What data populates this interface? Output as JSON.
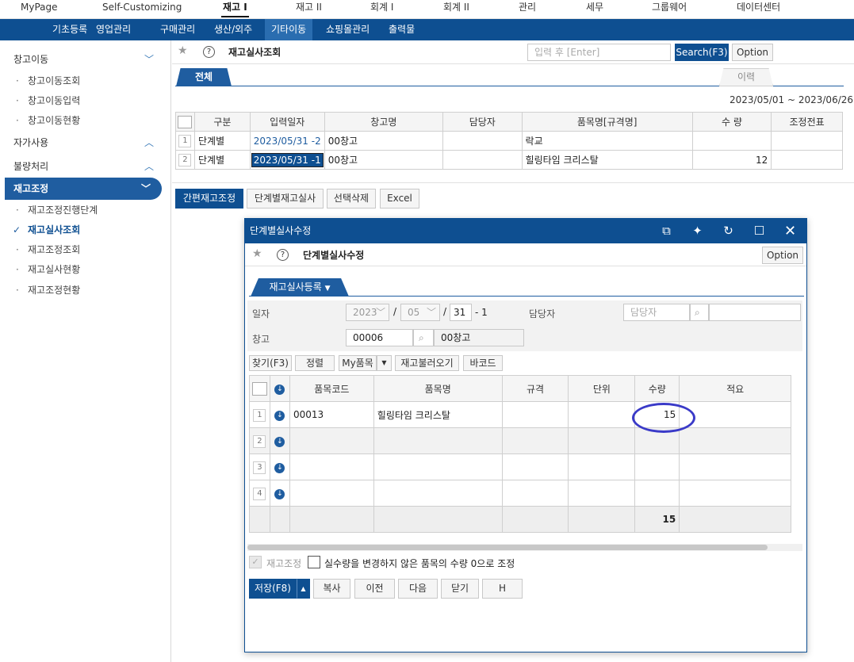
{
  "top_menu": [
    "MyPage",
    "Self-Customizing",
    "재고 I",
    "재고 II",
    "회계 I",
    "회계 II",
    "관리",
    "세무",
    "그룹웨어",
    "데이터센터"
  ],
  "sub_menu": [
    "기초등록",
    "영업관리",
    "구매관리",
    "생산/외주",
    "기타이동",
    "쇼핑몰관리",
    "출력물"
  ],
  "sidebar": {
    "g1": "창고이동",
    "g1_items": [
      "창고이동조회",
      "창고이동입력",
      "창고이동현황"
    ],
    "g2": "자가사용",
    "g3": "불량처리",
    "g4": "재고조정",
    "g4_items": [
      "재고조정진행단계",
      "재고실사조회",
      "재고조정조회",
      "재고실사현황",
      "재고조정현황"
    ]
  },
  "page": {
    "title": "재고실사조회",
    "search_placeholder": "입력 후 [Enter]",
    "search_btn": "Search(F3)",
    "option_btn": "Option",
    "tab_all": "전체",
    "tab_history": "이력",
    "date_range": "2023/05/01 ~ 2023/06/26"
  },
  "main_table": {
    "headers": [
      "구분",
      "입력일자",
      "창고명",
      "담당자",
      "품목명[규격명]",
      "수 량",
      "조정전표"
    ],
    "rows": [
      {
        "num": "1",
        "type": "단계별",
        "date": "2023/05/31 -2",
        "warehouse": "00창고",
        "manager": "",
        "item": "락교",
        "qty": "",
        "slip": ""
      },
      {
        "num": "2",
        "type": "단계별",
        "date": "2023/05/31 -1",
        "warehouse": "00창고",
        "manager": "",
        "item": "힐링타임 크리스탈",
        "qty": "12",
        "slip": ""
      }
    ]
  },
  "bottom_buttons": [
    "간편재고조정",
    "단계별재고실사",
    "선택삭제",
    "Excel"
  ],
  "dialog": {
    "title": "단계별실사수정",
    "header_title": "단계별실사수정",
    "option_btn": "Option",
    "tab": "재고실사등록",
    "label_date": "일자",
    "year": "2023",
    "month": "05",
    "day": "31",
    "seq": "- 1",
    "label_manager": "담당자",
    "manager_placeholder": "담당자",
    "label_warehouse": "창고",
    "warehouse_code": "00006",
    "warehouse_name": "00창고",
    "tool_buttons": [
      "찾기(F3)",
      "정렬",
      "My품목",
      "재고불러오기",
      "바코드"
    ],
    "grid_headers": [
      "품목코드",
      "품목명",
      "규격",
      "단위",
      "수량",
      "적요"
    ],
    "grid_rows": [
      {
        "num": "1",
        "code": "00013",
        "name": "힐링타임 크리스탈",
        "spec": "",
        "unit": "",
        "qty": "15",
        "memo": ""
      },
      {
        "num": "2",
        "code": "",
        "name": "",
        "spec": "",
        "unit": "",
        "qty": "",
        "memo": ""
      },
      {
        "num": "3",
        "code": "",
        "name": "",
        "spec": "",
        "unit": "",
        "qty": "",
        "memo": ""
      },
      {
        "num": "4",
        "code": "",
        "name": "",
        "spec": "",
        "unit": "",
        "qty": "",
        "memo": ""
      }
    ],
    "total_qty": "15",
    "chk_adjust": "재고조정",
    "chk_zero": "실수량을 변경하지 않은 품목의 수량 0으로 조정",
    "footer_buttons": [
      "저장(F8)",
      "복사",
      "이전",
      "다음",
      "닫기",
      "H"
    ]
  }
}
